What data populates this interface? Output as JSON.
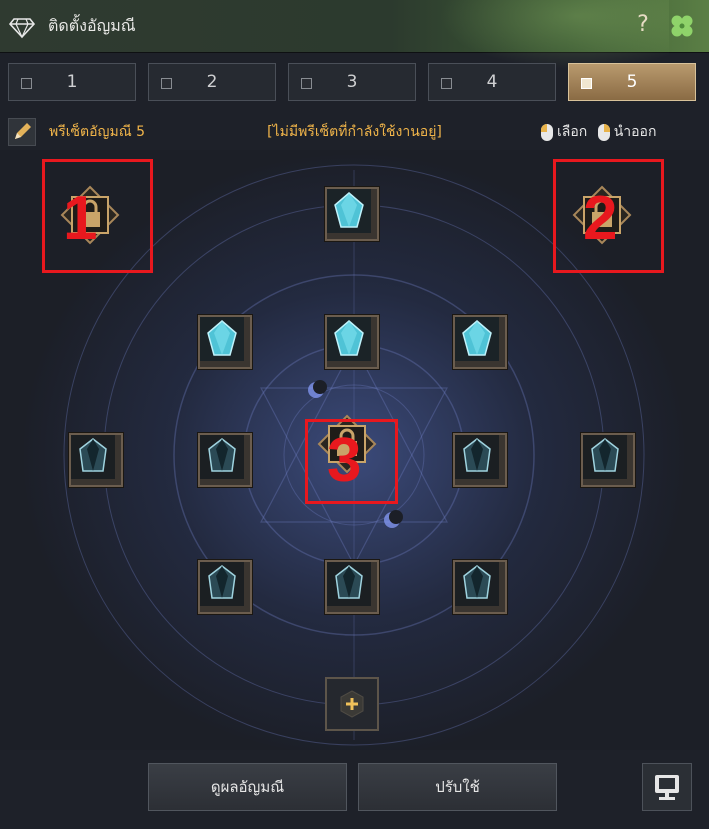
{
  "window": {
    "title": "ติดตั้งอัญมณี",
    "help_label": "?",
    "icons": {
      "title": "diamond-icon",
      "clover": "clover-icon"
    }
  },
  "tabs": [
    {
      "label": "1",
      "active": false
    },
    {
      "label": "2",
      "active": false
    },
    {
      "label": "3",
      "active": false
    },
    {
      "label": "4",
      "active": false
    },
    {
      "label": "5",
      "active": true
    }
  ],
  "preset": {
    "name": "พรีเซ็ตอัญมณี 5",
    "status": "[ไม่มีพรีเซ็ตที่กำลังใช้งานอยู่]"
  },
  "legend": {
    "select_label": "เลือก",
    "remove_label": "นำออก"
  },
  "annotations": [
    "1",
    "2",
    "3"
  ],
  "buttons": {
    "view_effects": "ดูผลอัญมณี",
    "apply": "ปรับใช้"
  },
  "colors": {
    "accent_gold": "#f1b54a",
    "active_tab": "#b99a6e",
    "annotation_red": "#e8181e",
    "gem_cyan": "#4fc3d6",
    "gem_dark": "#2b4a55"
  }
}
